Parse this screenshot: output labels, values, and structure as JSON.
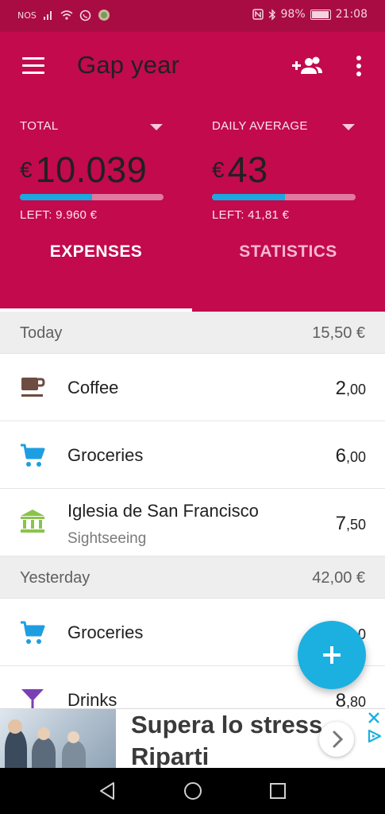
{
  "status_bar": {
    "carrier": "NOS",
    "battery": "98%",
    "time": "21:08",
    "icons": [
      "signal-icon",
      "wifi-icon",
      "whatsapp-icon",
      "app-notification-icon",
      "nfc-icon",
      "bluetooth-icon",
      "battery-icon"
    ]
  },
  "header": {
    "title": "Gap year",
    "total": {
      "label": "TOTAL",
      "currency": "€",
      "amount": "10.039",
      "left": "LEFT: 9.960 €",
      "progress": 0.5
    },
    "daily": {
      "label": "DAILY AVERAGE",
      "currency": "€",
      "amount": "43",
      "left": "LEFT: 41,81 €",
      "progress": 0.51
    }
  },
  "tabs": [
    {
      "label": "EXPENSES",
      "active": true
    },
    {
      "label": "STATISTICS",
      "active": false
    }
  ],
  "days": [
    {
      "label": "Today",
      "total": "15,50 €",
      "items": [
        {
          "name": "Coffee",
          "category": "",
          "amount_int": "2",
          "amount_dec": ",00",
          "icon": "coffee-cup-icon",
          "icon_color": "#6d4c41"
        },
        {
          "name": "Groceries",
          "category": "",
          "amount_int": "6",
          "amount_dec": ",00",
          "icon": "shopping-cart-icon",
          "icon_color": "#1e9ee2"
        },
        {
          "name": "Iglesia de San Francisco",
          "category": "Sightseeing",
          "amount_int": "7",
          "amount_dec": ",50",
          "icon": "museum-icon",
          "icon_color": "#8bc34a"
        }
      ]
    },
    {
      "label": "Yesterday",
      "total": "42,00 €",
      "items": [
        {
          "name": "Groceries",
          "category": "",
          "amount_int": "",
          "amount_dec": "0",
          "icon": "shopping-cart-icon",
          "icon_color": "#1e9ee2"
        },
        {
          "name": "Drinks",
          "category": "",
          "amount_int": "8",
          "amount_dec": ",80",
          "icon": "cocktail-glass-icon",
          "icon_color": "#7b3fb4"
        }
      ]
    }
  ],
  "ad": {
    "line1": "Supera lo stress,",
    "line2": "Riparti"
  },
  "colors": {
    "primary": "#c20a4d",
    "status_bar": "#a80c43",
    "accent": "#1bb0e0"
  }
}
